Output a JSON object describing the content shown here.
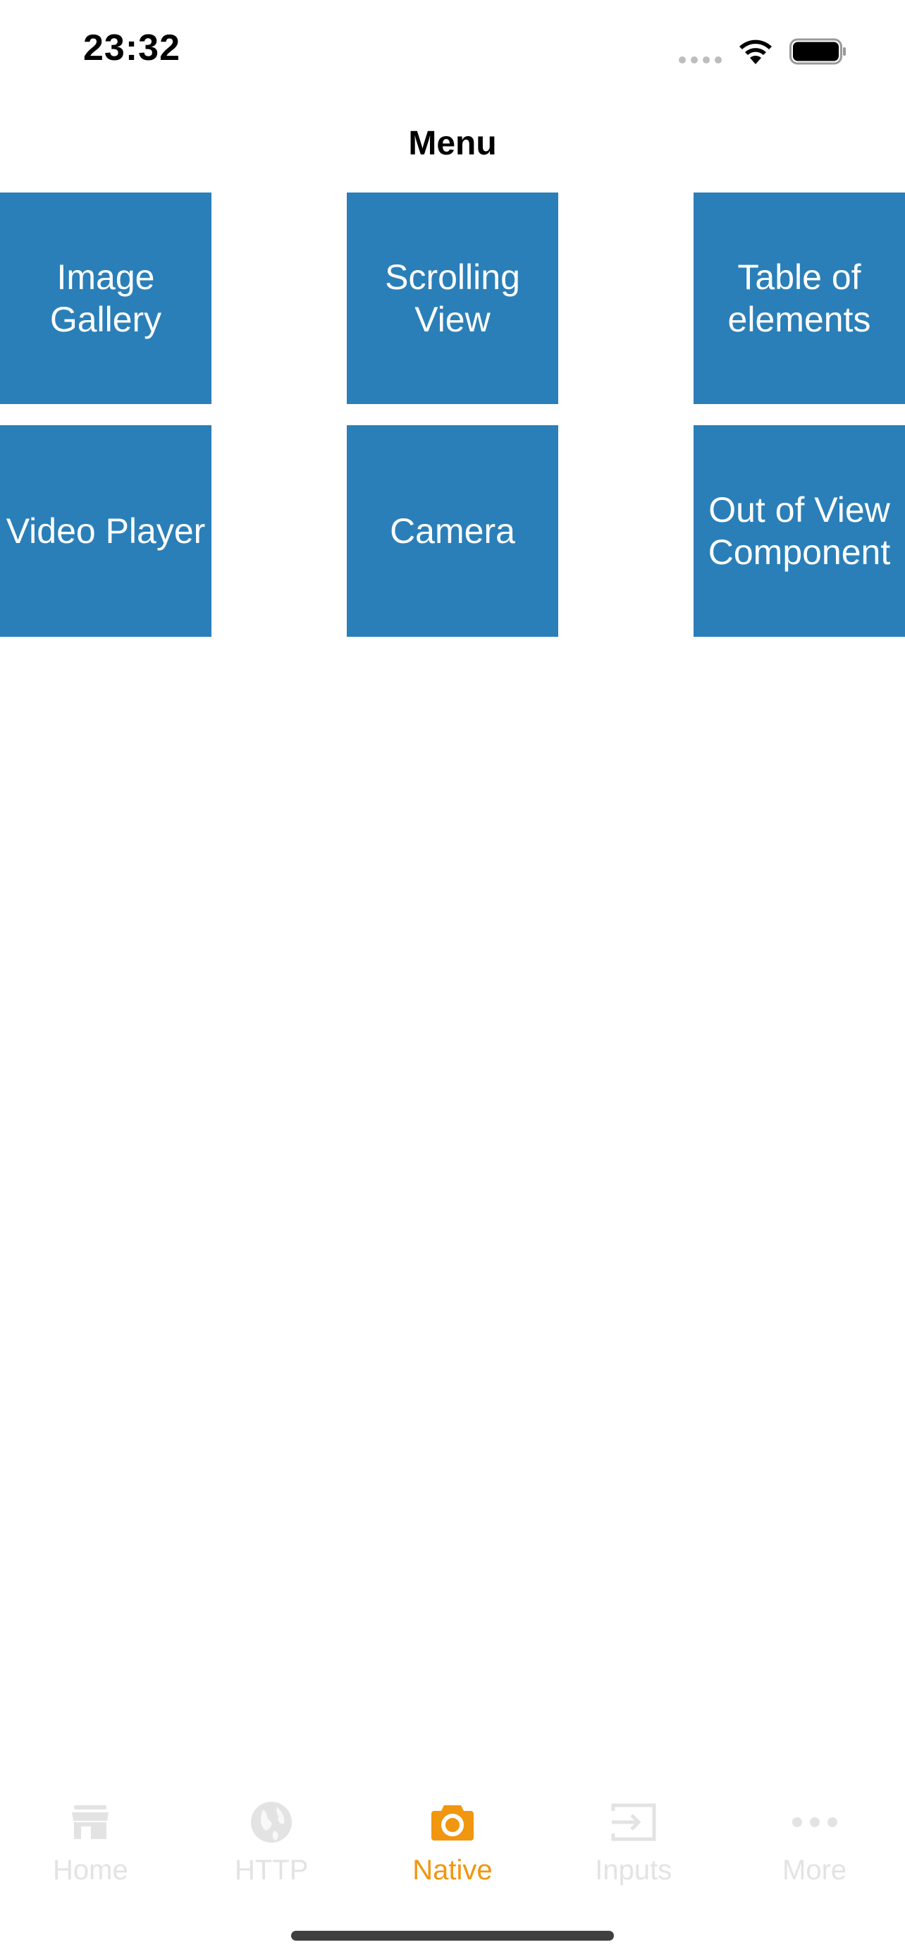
{
  "status_bar": {
    "time": "23:32",
    "icons": [
      "signal-dots-icon",
      "wifi-icon",
      "battery-icon"
    ]
  },
  "nav": {
    "title": "Menu"
  },
  "tiles": [
    {
      "label": "Image Gallery"
    },
    {
      "label": "Scrolling\nView"
    },
    {
      "label": "Table of\nelements"
    },
    {
      "label": "Video Player"
    },
    {
      "label": "Camera"
    },
    {
      "label": "Out of View\nComponent"
    }
  ],
  "tab_bar": {
    "items": [
      {
        "label": "Home",
        "icon": "store-icon",
        "active": false
      },
      {
        "label": "HTTP",
        "icon": "globe-icon",
        "active": false
      },
      {
        "label": "Native",
        "icon": "camera-icon",
        "active": true
      },
      {
        "label": "Inputs",
        "icon": "input-icon",
        "active": false
      },
      {
        "label": "More",
        "icon": "more-icon",
        "active": false
      }
    ]
  },
  "colors": {
    "tile_background": "#2a7fb8",
    "tile_text": "#ffffff",
    "tab_active": "#f1960f",
    "tab_inactive": "#e3e3e3"
  }
}
